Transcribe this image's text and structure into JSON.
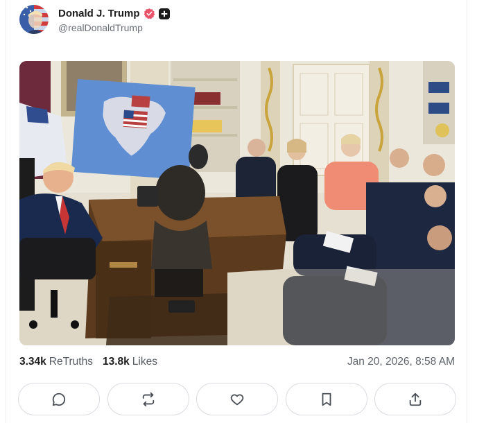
{
  "post": {
    "author": {
      "display_name": "Donald J. Trump",
      "handle": "@realDonaldTrump",
      "verified": true,
      "badge_icon": "plus-badge-icon"
    },
    "media": {
      "type": "photo",
      "description_visible": false
    },
    "stats": {
      "retruths_count": "3.34k",
      "retruths_label": "ReTruths",
      "likes_count": "13.8k",
      "likes_label": "Likes"
    },
    "timestamp": "Jan 20, 2026, 8:58 AM"
  },
  "actions": [
    {
      "name": "reply",
      "icon": "comment-icon"
    },
    {
      "name": "retruth",
      "icon": "repost-icon"
    },
    {
      "name": "like",
      "icon": "heart-icon"
    },
    {
      "name": "bookmark",
      "icon": "bookmark-icon"
    },
    {
      "name": "share",
      "icon": "share-icon"
    }
  ],
  "colors": {
    "verified_badge": "#e9546b",
    "border": "#d9dbe0",
    "text_primary": "#1c1c1c",
    "text_secondary": "#6b6f76"
  }
}
